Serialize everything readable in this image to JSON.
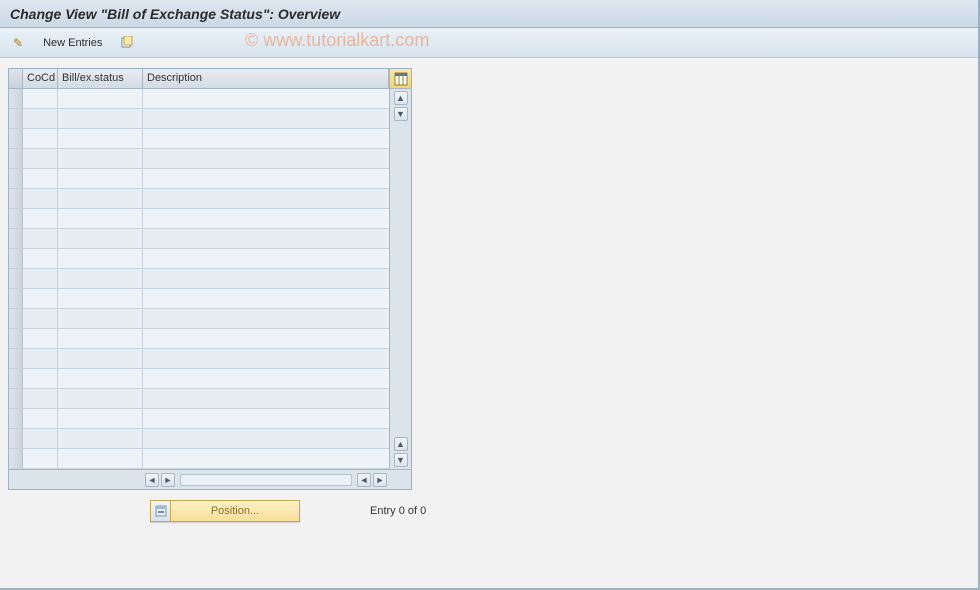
{
  "header": {
    "title": "Change View \"Bill of Exchange Status\": Overview"
  },
  "toolbar": {
    "new_entries_label": "New Entries"
  },
  "watermark": "© www.tutorialkart.com",
  "table": {
    "columns": {
      "cocd": "CoCd",
      "bill_status": "Bill/ex.status",
      "description": "Description"
    },
    "row_count": 19
  },
  "footer": {
    "position_button": "Position...",
    "entry_status": "Entry 0 of 0"
  }
}
